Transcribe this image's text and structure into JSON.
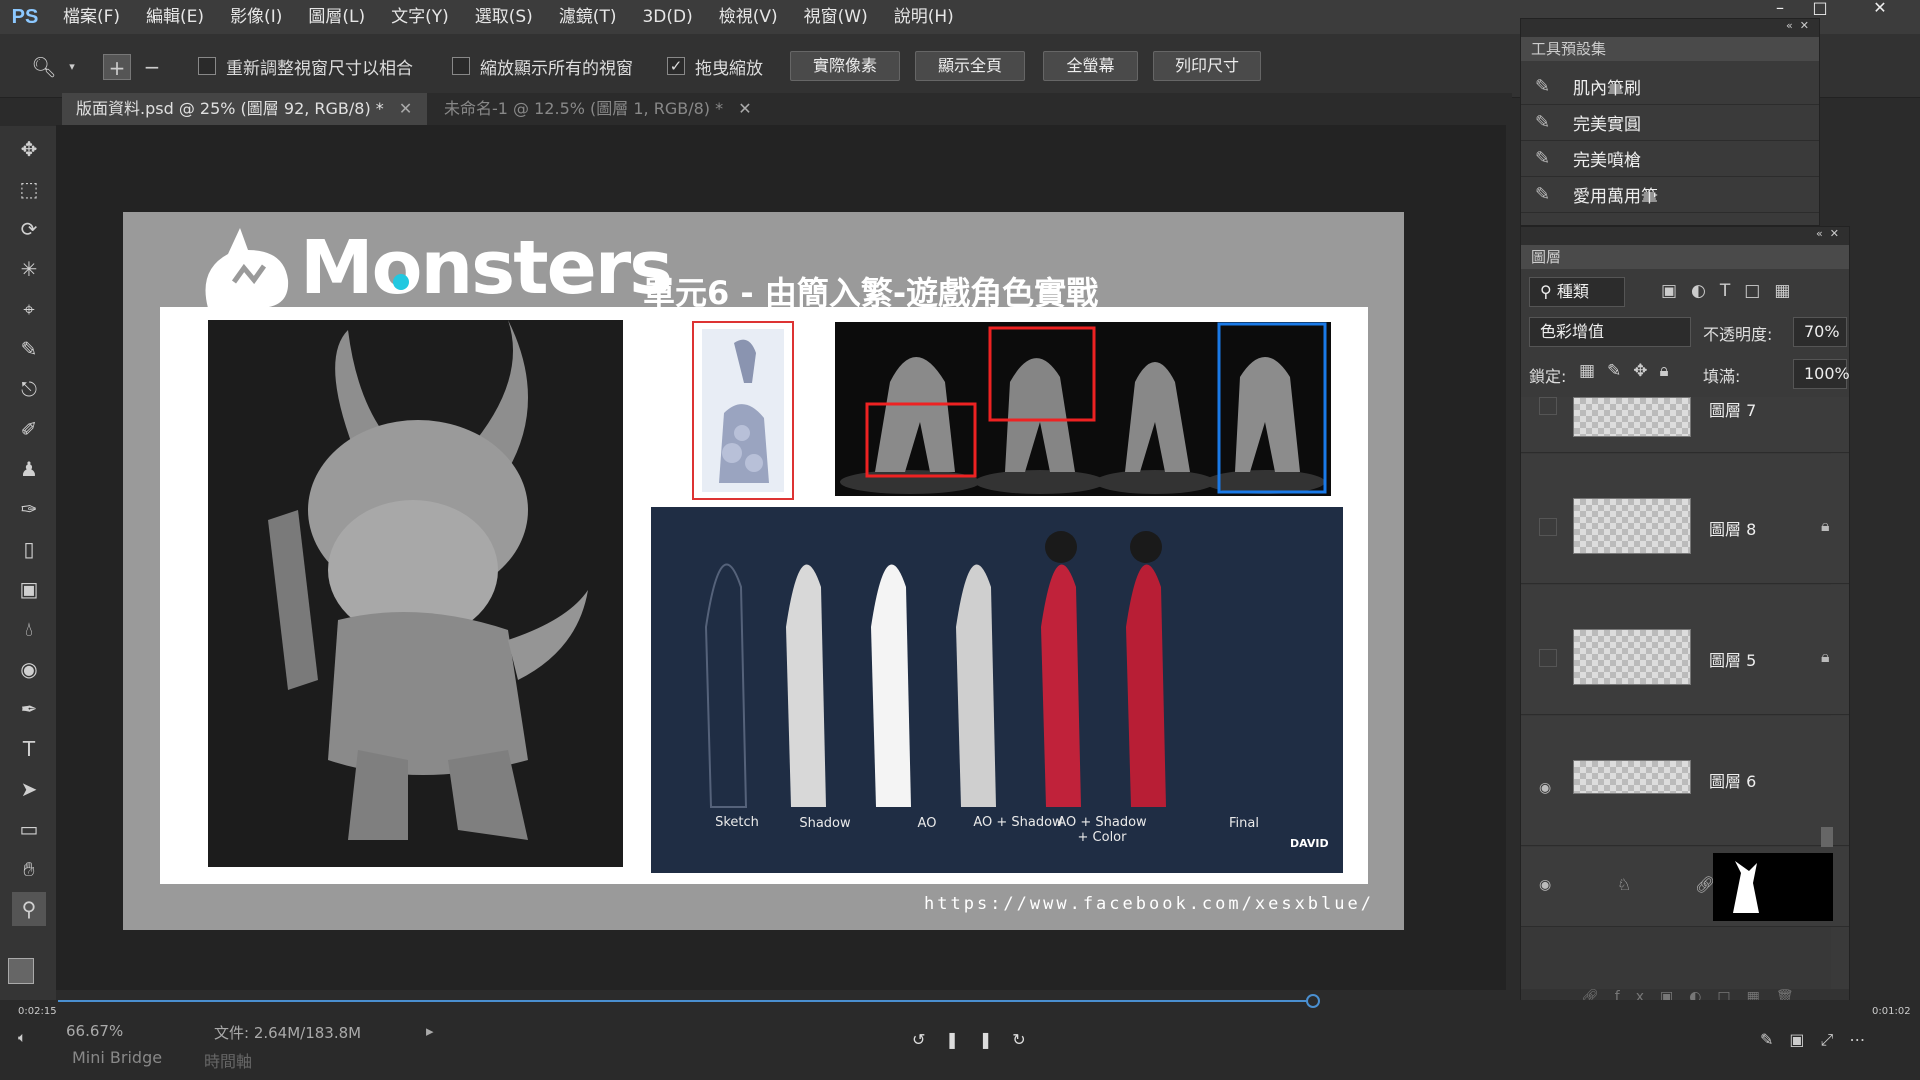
{
  "app": {
    "logo": "PS",
    "menu": [
      "檔案(F)",
      "編輯(E)",
      "影像(I)",
      "圖層(L)",
      "文字(Y)",
      "選取(S)",
      "濾鏡(T)",
      "3D(D)",
      "檢視(V)",
      "視窗(W)",
      "說明(H)"
    ],
    "window_controls": [
      "–",
      "□",
      "✕"
    ]
  },
  "options_bar": {
    "checks": [
      {
        "label": "重新調整視窗尺寸以相合",
        "checked": false
      },
      {
        "label": "縮放顯示所有的視窗",
        "checked": false
      },
      {
        "label": "拖曳縮放",
        "checked": true
      }
    ],
    "buttons": [
      "實際像素",
      "顯示全頁",
      "全螢幕",
      "列印尺寸"
    ]
  },
  "tabs": [
    {
      "label": "版面資料.psd @ 25% (圖層 92, RGB/8) *",
      "active": true
    },
    {
      "label": "未命名-1 @ 12.5% (圖層 1, RGB/8) *",
      "active": false
    }
  ],
  "slide": {
    "logo_text": "Monsters",
    "subtitle": "單元6 - 由簡入繁-遊戲角色實戰",
    "url": "https://www.facebook.com/xesxblue/",
    "stage_labels": [
      "Sketch",
      "Shadow",
      "AO",
      "AO + Shadow",
      "AO + Shadow\n+ Color",
      "Final"
    ],
    "signature": "DAVID"
  },
  "tool_presets": {
    "title": "工具預設集",
    "items": [
      "肌內筆刷",
      "完美實圓",
      "完美噴槍",
      "愛用萬用筆"
    ]
  },
  "layers": {
    "title": "圖層",
    "filter_label": "種類",
    "blend_mode": "色彩增值",
    "opacity_label": "不透明度:",
    "opacity_value": "70%",
    "lock_label": "鎖定:",
    "fill_label": "填滿:",
    "fill_value": "100%",
    "items": [
      {
        "name": "圖層 7",
        "locked": false
      },
      {
        "name": "圖層 8",
        "locked": true
      },
      {
        "name": "圖層 5",
        "locked": true
      },
      {
        "name": "圖層 6",
        "locked": false
      }
    ]
  },
  "status": {
    "zoom": "66.67%",
    "doc_info": "文件: 2.64M/183.8M",
    "mini_bridge": "Mini Bridge",
    "timeline_tab": "時間軸"
  },
  "playback": {
    "elapsed": "0:02:15",
    "total": "0:01:02",
    "progress": 0.77
  }
}
